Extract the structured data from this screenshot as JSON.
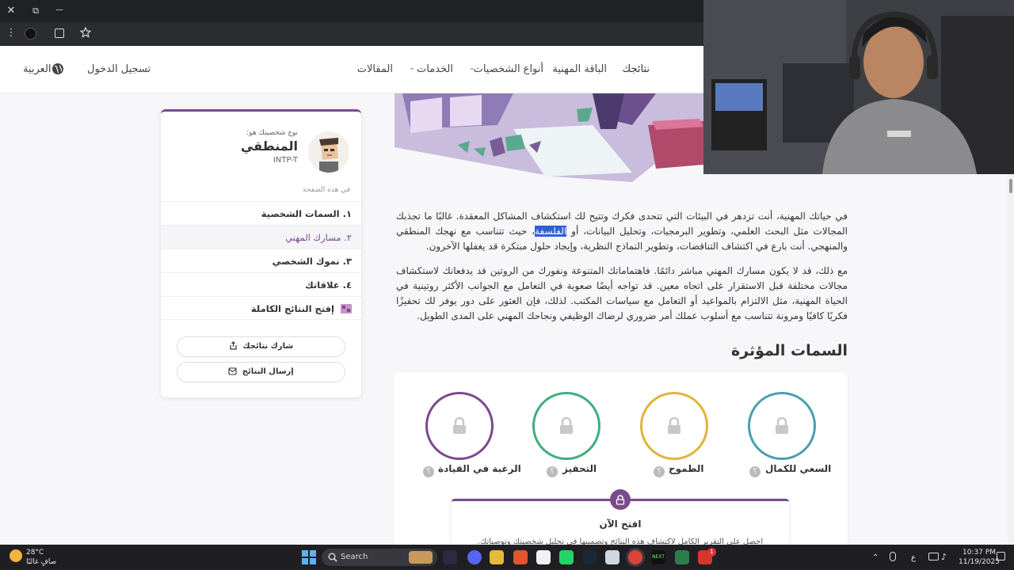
{
  "browser": {
    "close_glyph": "✕",
    "restore_glyph": "⧉",
    "minimize_glyph": "—",
    "menu_glyph": "⋮"
  },
  "header": {
    "nav": [
      "نتائجك",
      "الباقة المهنية",
      "أنواع الشخصيات",
      "الخدمات",
      "المقالات"
    ],
    "login": "تسجيل الدخول",
    "language": "العربية"
  },
  "article": {
    "p1_before": "في حياتك المهنية، أنت تزدهر في البيئات التي تتحدى فكرك وتتيح لك استكشاف المشاكل المعقدة. غالبًا ما تجذبك المجالات مثل البحث العلمي، وتطوير البرمجيات، وتحليل البيانات، أو ",
    "p1_highlight": "الفلسفة",
    "p1_after": "، حيث تتناسب مع نهجك المنطقي والمنهجي. أنت بارع في اكتشاف التناقضات، وتطوير النماذج النظرية، وإيجاد حلول مبتكرة قد يغفلها الآخرون.",
    "p2": "مع ذلك، قد لا يكون مسارك المهني مباشر دائمًا. فاهتماماتك المتنوعة ونفورك من الروتين قد يدفعانك لاستكشاف مجالات مختلفة قبل الاستقرار على اتجاه معين. قد تواجه أيضًا صعوبة في التعامل مع الجوانب الأكثر روتينية في الحياة المهنية، مثل الالتزام بالمواعيد أو التعامل مع سياسات المكتب. لذلك، فإن العثور على دور يوفر لك تحفيزًا فكريًا كافيًا ومرونة تتناسب مع أسلوب عملك أمر ضروري لرضاك الوظيفي ونجاحك المهني على المدى الطويل.",
    "traits_title": "السمات المؤثرة",
    "traits": [
      {
        "label": "السعي للكمال",
        "color": "#4a9fb0"
      },
      {
        "label": "الطموح",
        "color": "#e0b43a"
      },
      {
        "label": "التحفيز",
        "color": "#3fae7b"
      },
      {
        "label": "الرغبة في القيادة",
        "color": "#7a4a8e"
      }
    ],
    "qmark": "؟",
    "unlock_title": "افتح الآن",
    "unlock_desc": "احصل على التقرير الكامل لاكتشاف هذه النتائج وتضمينها في تحليل شخصيتك وتوصياتك."
  },
  "sidebar": {
    "type_label": "نوع شخصيتك هو:",
    "type_name": "المنطقي",
    "type_code": "INTP-T",
    "on_page": "في هذه الصفحة",
    "toc": [
      "١. السمات الشخصية",
      "٢. مسارك المهني",
      "٣. نموك الشخصي",
      "٤. علاقاتك",
      "إفتح النتائج الكاملة"
    ],
    "share": "شارك نتائجك",
    "send": "إرسال النتائج"
  },
  "taskbar": {
    "temp": "28°C",
    "weather": "صافٍ غالبًا",
    "search": "Search",
    "lang": "ع",
    "time": "10:37 PM",
    "date": "11/19/2025",
    "badge": "1"
  },
  "colors": {
    "accent": "#7a4a8e",
    "selection": "#2f5fd0"
  }
}
